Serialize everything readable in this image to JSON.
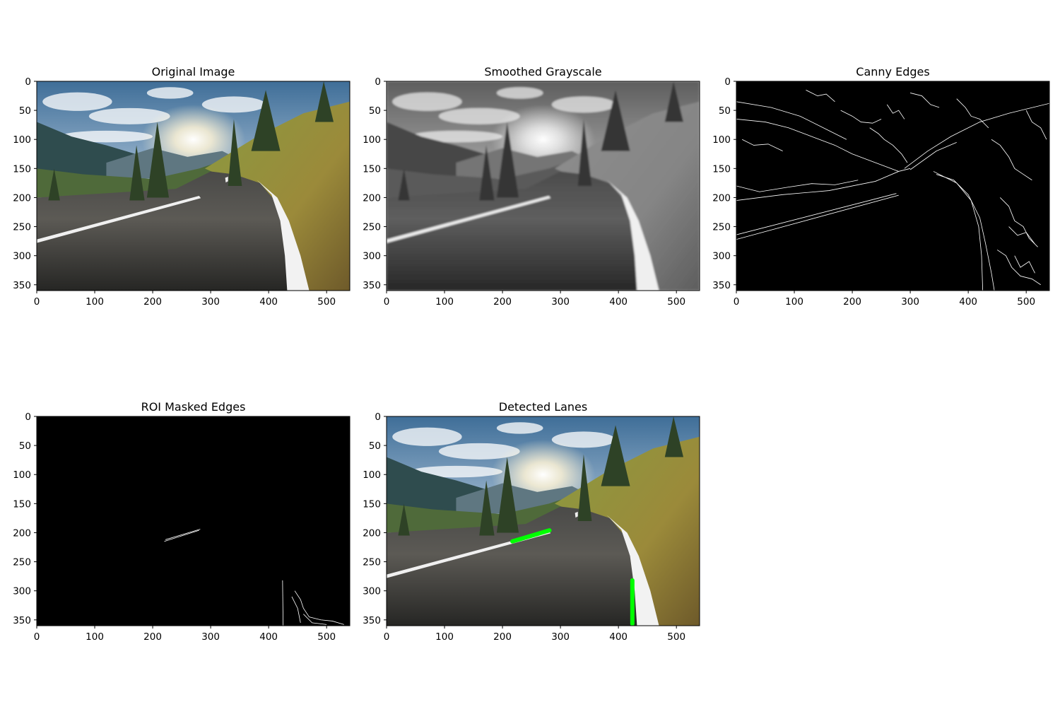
{
  "figure": {
    "background": "#ffffff",
    "axis_color": "#000000",
    "lane_color": "#00ff00",
    "edge_color": "#ffffff"
  },
  "chart_data": [
    {
      "type": "image",
      "title": "Original Image",
      "image": "road-photo-color",
      "xlim": [
        0,
        540
      ],
      "ylim": [
        360,
        0
      ],
      "xticks": [
        0,
        100,
        200,
        300,
        400,
        500
      ],
      "yticks": [
        0,
        50,
        100,
        150,
        200,
        250,
        300,
        350
      ]
    },
    {
      "type": "image",
      "title": "Smoothed Grayscale",
      "image": "road-photo-grayscale-blurred",
      "xlim": [
        0,
        540
      ],
      "ylim": [
        360,
        0
      ],
      "xticks": [
        0,
        100,
        200,
        300,
        400,
        500
      ],
      "yticks": [
        0,
        50,
        100,
        150,
        200,
        250,
        300,
        350
      ]
    },
    {
      "type": "image",
      "title": "Canny Edges",
      "image": "edge-map",
      "xlim": [
        0,
        540
      ],
      "ylim": [
        360,
        0
      ],
      "xticks": [
        0,
        100,
        200,
        300,
        400,
        500
      ],
      "yticks": [
        0,
        50,
        100,
        150,
        200,
        250,
        300,
        350
      ]
    },
    {
      "type": "image",
      "title": "ROI Masked Edges",
      "image": "masked-edge-map",
      "xlim": [
        0,
        540
      ],
      "ylim": [
        360,
        0
      ],
      "xticks": [
        0,
        100,
        200,
        300,
        400,
        500
      ],
      "yticks": [
        0,
        50,
        100,
        150,
        200,
        250,
        300,
        350
      ]
    },
    {
      "type": "image",
      "title": "Detected Lanes",
      "image": "road-photo-with-lanes",
      "xlim": [
        0,
        540
      ],
      "ylim": [
        360,
        0
      ],
      "xticks": [
        0,
        100,
        200,
        300,
        400,
        500
      ],
      "yticks": [
        0,
        50,
        100,
        150,
        200,
        250,
        300,
        350
      ],
      "lanes": [
        {
          "x1": 217,
          "y1": 215,
          "x2": 281,
          "y2": 196
        },
        {
          "x1": 424,
          "y1": 282,
          "x2": 424,
          "y2": 357
        }
      ]
    }
  ]
}
